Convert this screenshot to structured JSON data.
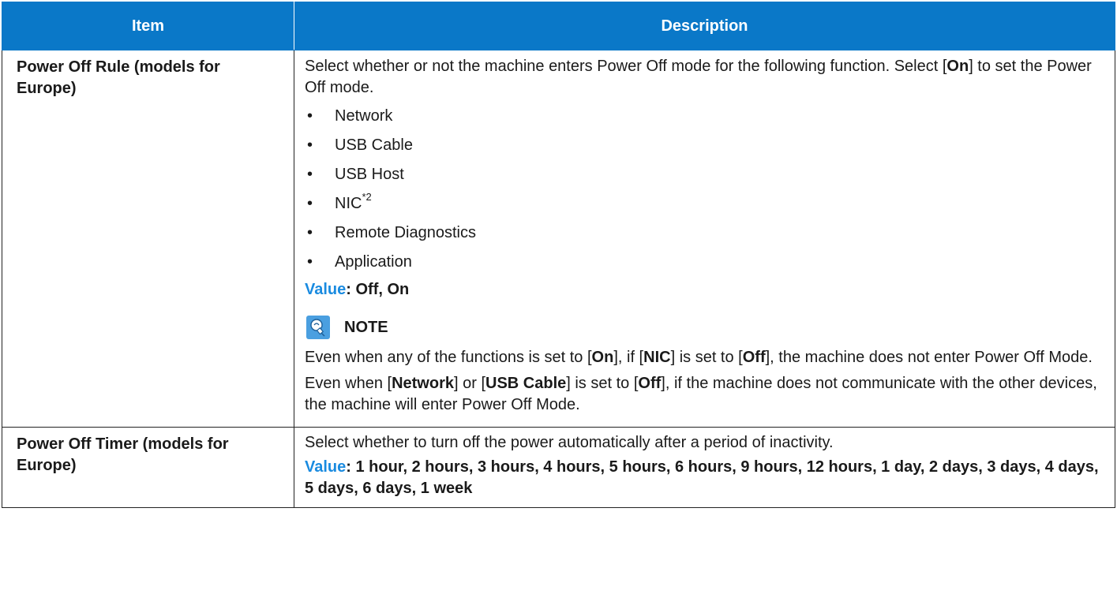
{
  "table": {
    "headers": {
      "item": "Item",
      "description": "Description"
    },
    "rows": [
      {
        "item": "Power Off Rule (models for Europe)",
        "intro_1": "Select whether or not the machine enters Power Off mode for the following function. Select [",
        "intro_bold": "On",
        "intro_2": "] to set the Power Off mode.",
        "bullets": [
          "Network",
          "USB Cable",
          "USB Host",
          "NIC",
          "Remote Diagnostics",
          "Application"
        ],
        "nic_superscript": "*2",
        "value_label": "Value",
        "value_text": ": Off, On",
        "note": {
          "title": "NOTE",
          "para1": {
            "t1": "Even when any of the functions is set to [",
            "b1": "On",
            "t2": "], if [",
            "b2": "NIC",
            "t3": "] is set to [",
            "b3": "Off",
            "t4": "], the machine does not enter Power Off Mode."
          },
          "para2": {
            "t1": "Even when [",
            "b1": "Network",
            "t2": "] or [",
            "b2": "USB Cable",
            "t3": "] is set to [",
            "b3": "Off",
            "t4": "], if the machine does not communicate with the other devices, the machine will enter Power Off Mode."
          }
        }
      },
      {
        "item": "Power Off Timer (models for Europe)",
        "description": "Select whether to turn off the power automatically after a period of inactivity.",
        "value_label": "Value",
        "value_text": ": 1 hour, 2 hours, 3 hours, 4 hours, 5 hours, 6 hours, 9 hours, 12 hours, 1 day, 2 days, 3 days, 4 days, 5 days, 6 days, 1 week"
      }
    ]
  },
  "colors": {
    "header_bg": "#0a78c8",
    "value_label": "#1a8be0",
    "note_icon_bg": "#4a9fe0"
  },
  "icons": {
    "note": "note-lightbulb-icon",
    "bullet": "bullet-dot"
  }
}
